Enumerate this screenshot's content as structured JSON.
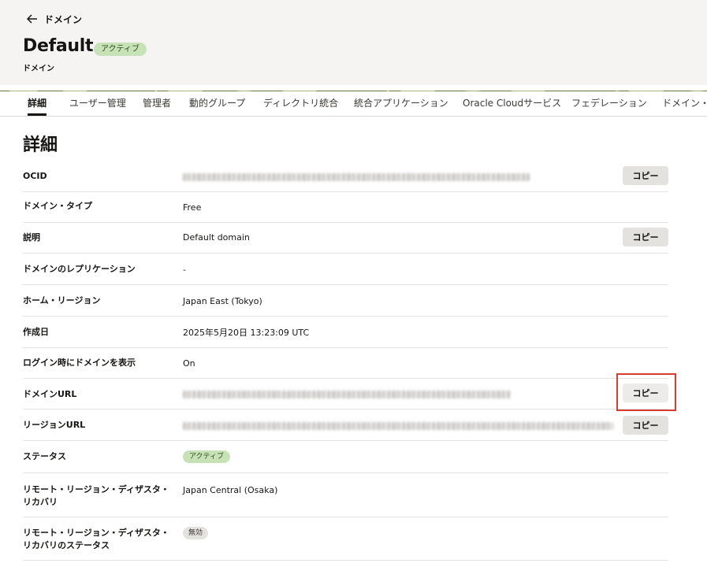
{
  "header": {
    "back_label": "ドメイン",
    "title": "Default",
    "status_badge": "アクティブ",
    "subtitle": "ドメイン"
  },
  "tabs": [
    {
      "label": "詳細",
      "active": true
    },
    {
      "label": "ユーザー管理"
    },
    {
      "label": "管理者"
    },
    {
      "label": "動的グループ"
    },
    {
      "label": "ディレクトリ統合"
    },
    {
      "label": "統合アプリケーション"
    },
    {
      "label": "Oracle Cloudサービス"
    },
    {
      "label": "フェデレーション"
    },
    {
      "label": "ドメイン・"
    }
  ],
  "section_title": "詳細",
  "copy_label": "コピー",
  "details": {
    "ocid": {
      "label": "OCID"
    },
    "domain_type": {
      "label": "ドメイン・タイプ",
      "value": "Free"
    },
    "description": {
      "label": "説明",
      "value": "Default domain"
    },
    "replication": {
      "label": "ドメインのレプリケーション",
      "value": "-"
    },
    "home_region": {
      "label": "ホーム・リージョン",
      "value": "Japan East (Tokyo)"
    },
    "created": {
      "label": "作成日",
      "value": "2025年5月20日 13:23:09 UTC"
    },
    "show_on_login": {
      "label": "ログイン時にドメインを表示",
      "value": "On"
    },
    "domain_url": {
      "label": "ドメインURL"
    },
    "region_url": {
      "label": "リージョンURL"
    },
    "status": {
      "label": "ステータス",
      "value": "アクティブ"
    },
    "dr": {
      "label": "リモート・リージョン・ディザスタ・リカバリ",
      "value": "Japan Central (Osaka)"
    },
    "dr_status": {
      "label": "リモート・リージョン・ディザスタ・リカバリのステータス",
      "value": "無効"
    }
  },
  "colors": {
    "active_badge": "#c8e2b8",
    "highlight_box": "#d83b30",
    "header_bg": "#f5f4f2"
  }
}
